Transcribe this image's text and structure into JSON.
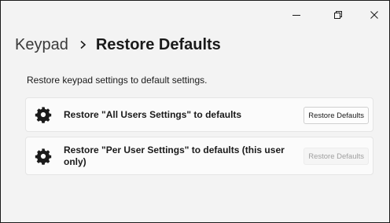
{
  "window": {
    "caption_buttons": [
      "minimize-icon",
      "maximize-icon",
      "close-icon"
    ]
  },
  "breadcrumb": {
    "parent": "Keypad",
    "separator_icon": "chevron-right-icon",
    "current": "Restore Defaults"
  },
  "description": "Restore keypad settings to default settings.",
  "cards": [
    {
      "icon": "gear-icon",
      "label": "Restore \"All Users Settings\" to defaults",
      "button_label": "Restore Defaults",
      "button_enabled": true
    },
    {
      "icon": "gear-icon",
      "label": "Restore \"Per User Settings\" to defaults (this user only)",
      "button_label": "Restore Defaults",
      "button_enabled": false
    }
  ],
  "colors": {
    "background": "#f3f3f3",
    "card": "#fbfbfb",
    "text": "#1a1a1a",
    "disabled_text": "#a0a0a0"
  }
}
